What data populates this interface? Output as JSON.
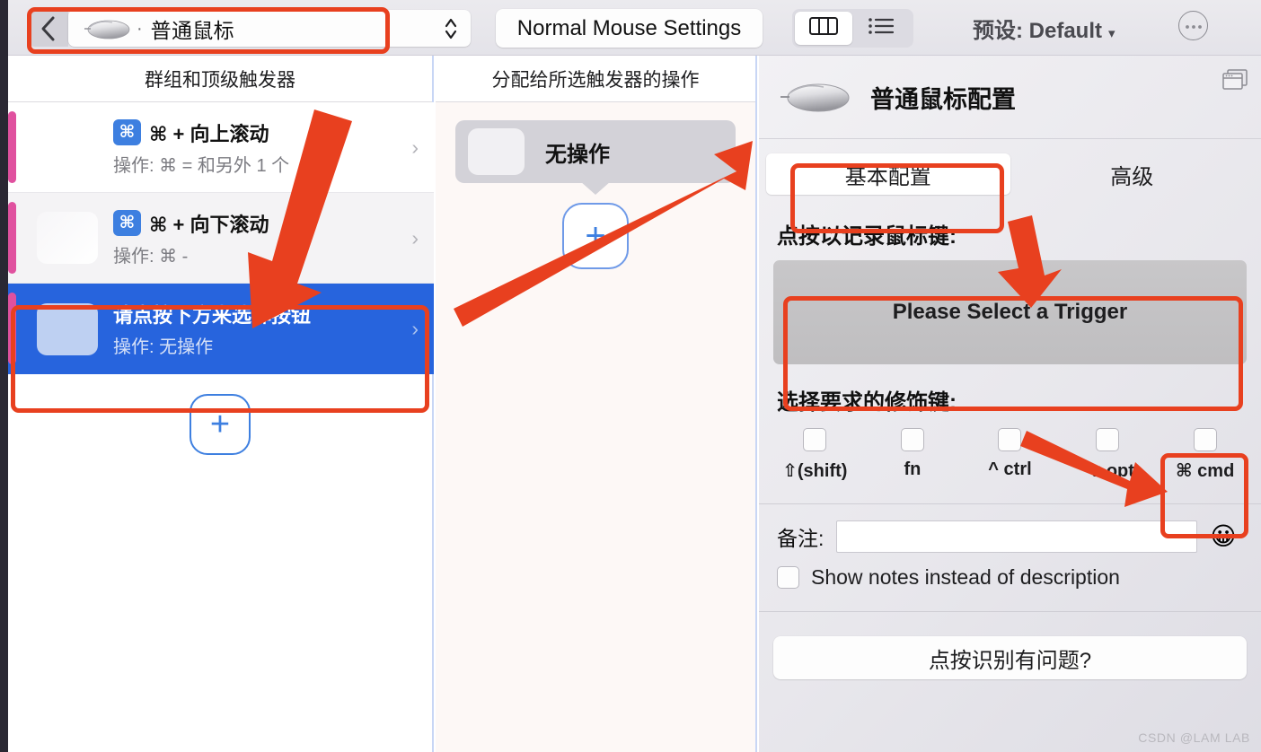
{
  "toolbar": {
    "back_icon": "chevron-left-icon",
    "device_name": "普通鼠标",
    "device_separator": "·",
    "device_icon": "mouse-icon",
    "stepper_icon": "up-down-chevrons-icon",
    "settings_label": "Normal Mouse Settings",
    "view_columns_icon": "columns-view-icon",
    "view_list_icon": "list-view-icon",
    "preset_label": "预设: Default",
    "preset_caret": "▾",
    "more_icon": "ellipsis-circle-icon"
  },
  "left_column": {
    "header": "群组和顶级触发器",
    "rows": [
      {
        "badge": "⌘",
        "title": "⌘ + 向上滚动",
        "subtitle": "操作: ⌘ = 和另外 1 个",
        "chevron": "›",
        "selected": false
      },
      {
        "badge": "⌘",
        "title": "⌘ + 向下滚动",
        "subtitle": "操作: ⌘ -",
        "chevron": "›",
        "selected": false
      },
      {
        "badge": "",
        "title": "请点按下方来选择按钮",
        "subtitle": "操作: 无操作",
        "chevron": "›",
        "selected": true
      }
    ],
    "add_button_label": "+"
  },
  "middle_column": {
    "header": "分配给所选触发器的操作",
    "action_label": "无操作",
    "add_button_label": "+"
  },
  "right_panel": {
    "device_icon": "mouse-icon",
    "title": "普通鼠标配置",
    "window_icon": "stacked-windows-icon",
    "tabs": [
      {
        "label": "基本配置",
        "active": true
      },
      {
        "label": "高级",
        "active": false
      }
    ],
    "trigger_section_label": "点按以记录鼠标键:",
    "trigger_button_label": "Please Select a Trigger",
    "modifier_section_label": "选择要求的修饰键:",
    "modifiers": [
      {
        "label": "⇧(shift)",
        "checked": false
      },
      {
        "label": "fn",
        "checked": false
      },
      {
        "label": "^ ctrl",
        "checked": false
      },
      {
        "label": "⌥ opt",
        "checked": false
      },
      {
        "label": "⌘ cmd",
        "checked": false
      }
    ],
    "notes_label": "备注:",
    "notes_value": "",
    "notes_placeholder": "",
    "emoji_button": "😀",
    "show_notes_label": "Show notes instead of description",
    "show_notes_checked": false,
    "help_button_label": "点按识别有问题?"
  },
  "annotations": {
    "accent_color": "#e8401f",
    "boxes": [
      "device-selector",
      "selected-trigger-row",
      "basic-config-tab",
      "trigger-button",
      "cmd-modifier"
    ],
    "arrows": [
      "header-to-selected-row",
      "action-card-to-upper-right",
      "tab-to-trigger-button",
      "modifier-label-to-cmd"
    ]
  },
  "watermark": "CSDN @LAM LAB",
  "colors": {
    "selection_blue": "#2764dd",
    "accent_red": "#e8401f",
    "strip_pink": "#e0519f",
    "add_blue": "#3d7fe0"
  }
}
